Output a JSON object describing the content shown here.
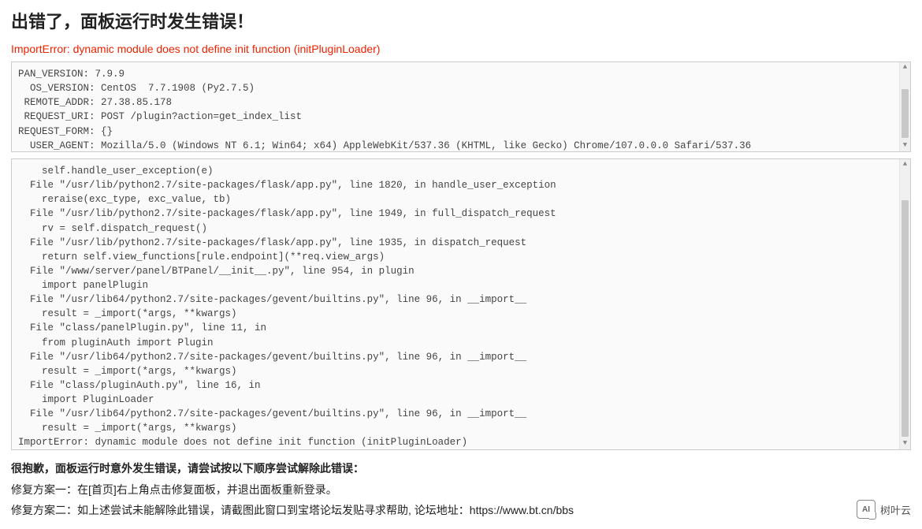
{
  "title": "出错了，面板运行时发生错误！",
  "error_message": "ImportError: dynamic module does not define init function (initPluginLoader)",
  "env_block": "PAN_VERSION: 7.9.9\n  OS_VERSION: CentOS  7.7.1908 (Py2.7.5)\n REMOTE_ADDR: 27.38.85.178\n REQUEST_URI: POST /plugin?action=get_index_list\nREQUEST_FORM: {}\n  USER_AGENT: Mozilla/5.0 (Windows NT 6.1; Win64; x64) AppleWebKit/537.36 (KHTML, like Gecko) Chrome/107.0.0.0 Safari/537.36",
  "traceback_block": "    self.handle_user_exception(e)\n  File \"/usr/lib/python2.7/site-packages/flask/app.py\", line 1820, in handle_user_exception\n    reraise(exc_type, exc_value, tb)\n  File \"/usr/lib/python2.7/site-packages/flask/app.py\", line 1949, in full_dispatch_request\n    rv = self.dispatch_request()\n  File \"/usr/lib/python2.7/site-packages/flask/app.py\", line 1935, in dispatch_request\n    return self.view_functions[rule.endpoint](**req.view_args)\n  File \"/www/server/panel/BTPanel/__init__.py\", line 954, in plugin\n    import panelPlugin\n  File \"/usr/lib64/python2.7/site-packages/gevent/builtins.py\", line 96, in __import__\n    result = _import(*args, **kwargs)\n  File \"class/panelPlugin.py\", line 11, in \n    from pluginAuth import Plugin\n  File \"/usr/lib64/python2.7/site-packages/gevent/builtins.py\", line 96, in __import__\n    result = _import(*args, **kwargs)\n  File \"class/pluginAuth.py\", line 16, in \n    import PluginLoader\n  File \"/usr/lib64/python2.7/site-packages/gevent/builtins.py\", line 96, in __import__\n    result = _import(*args, **kwargs)\nImportError: dynamic module does not define init function (initPluginLoader)",
  "advice": {
    "heading": "很抱歉，面板运行时意外发生错误，请尝试按以下顺序尝试解除此错误：",
    "line1": "修复方案一：在[首页]右上角点击修复面板，并退出面板重新登录。",
    "line2": "修复方案二：如上述尝试未能解除此错误，请截图此窗口到宝塔论坛发贴寻求帮助, 论坛地址：https://www.bt.cn/bbs"
  },
  "brand": {
    "logo_text": "AI",
    "name": "树叶云"
  }
}
